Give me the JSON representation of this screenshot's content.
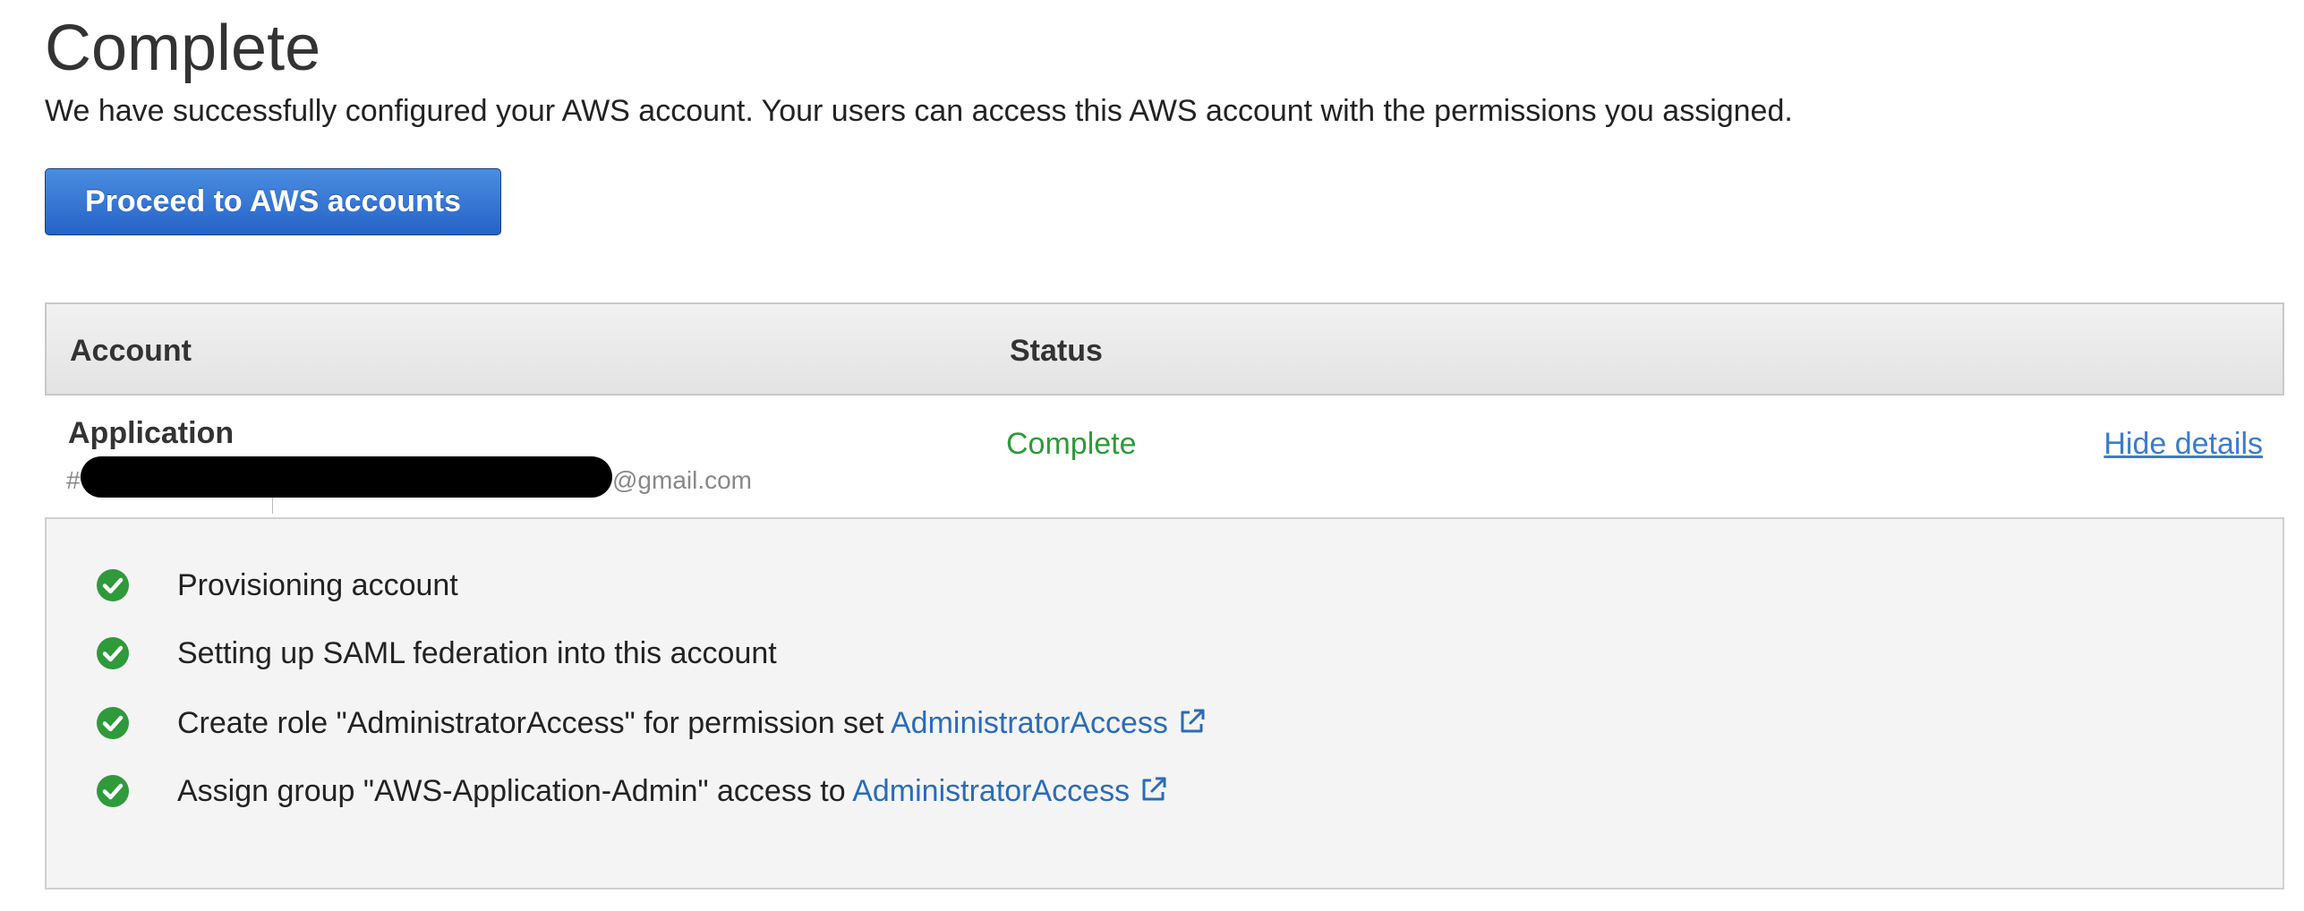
{
  "header": {
    "title": "Complete",
    "message": "We have successfully configured your AWS account. Your users can access this AWS account with the permissions you assigned."
  },
  "actions": {
    "proceed_label": "Proceed to AWS accounts"
  },
  "table": {
    "columns": [
      "Account",
      "Status"
    ],
    "rows": [
      {
        "account_name": "Application",
        "account_id_prefix": "#",
        "account_email_suffix": "@gmail.com",
        "status": "Complete",
        "toggle_label": "Hide details"
      }
    ]
  },
  "details": {
    "steps": [
      {
        "text": "Provisioning account",
        "link": ""
      },
      {
        "text": "Setting up SAML federation into this account",
        "link": ""
      },
      {
        "text": "Create role \"AdministratorAccess\" for permission set ",
        "link": "AdministratorAccess"
      },
      {
        "text": "Assign group \"AWS-Application-Admin\" access to ",
        "link": "AdministratorAccess"
      }
    ]
  },
  "colors": {
    "primary_button": "#2563c8",
    "success": "#2e9a3a",
    "link": "#2a6cb8",
    "panel_background": "#f4f4f4"
  },
  "icons": {
    "step_status": "check-circle-icon",
    "external_link": "external-link-icon"
  }
}
